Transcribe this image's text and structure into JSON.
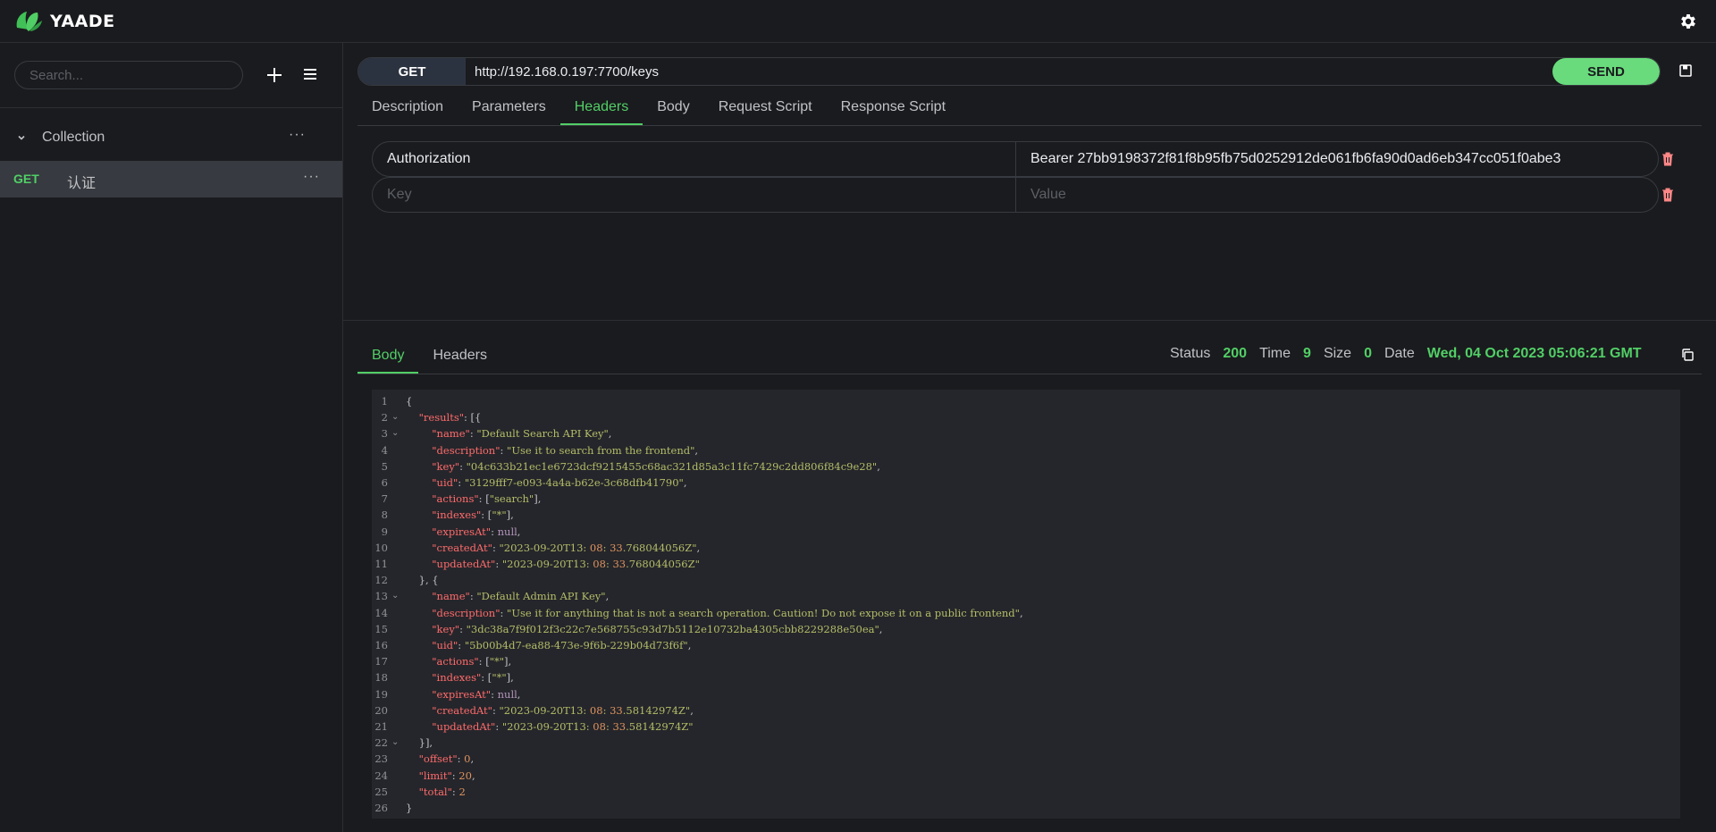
{
  "app": {
    "name": "YAADE"
  },
  "sidebar": {
    "search_placeholder": "Search...",
    "collection": {
      "label": "Collection"
    },
    "requests": [
      {
        "method": "GET",
        "name": "认证"
      }
    ]
  },
  "request": {
    "method": "GET",
    "url": "http://192.168.0.197:7700/keys",
    "send_label": "SEND",
    "tabs": [
      "Description",
      "Parameters",
      "Headers",
      "Body",
      "Request Script",
      "Response Script"
    ],
    "active_tab": "Headers",
    "headers": [
      {
        "key": "Authorization",
        "value": "Bearer 27bb9198372f81f8b95fb75d0252912de061fb6fa90d0ad6eb347cc051f0abe3"
      }
    ],
    "key_placeholder": "Key",
    "value_placeholder": "Value"
  },
  "response": {
    "tabs": [
      "Body",
      "Headers"
    ],
    "active_tab": "Body",
    "status_label": "Status",
    "status": "200",
    "time_label": "Time",
    "time": "9",
    "size_label": "Size",
    "size": "0",
    "date_label": "Date",
    "date": "Wed, 04 Oct 2023 05:06:21 GMT",
    "body_lines": [
      "{",
      "    \"results\": [{",
      "        \"name\": \"Default Search API Key\",",
      "        \"description\": \"Use it to search from the frontend\",",
      "        \"key\": \"04c633b21ec1e6723dcf9215455c68ac321d85a3c11fc7429c2dd806f84c9e28\",",
      "        \"uid\": \"3129fff7-e093-4a4a-b62e-3c68dfb41790\",",
      "        \"actions\": [\"search\"],",
      "        \"indexes\": [\"*\"],",
      "        \"expiresAt\": null,",
      "        \"createdAt\": \"2023-09-20T13:08:33.768044056Z\",",
      "        \"updatedAt\": \"2023-09-20T13:08:33.768044056Z\"",
      "    }, {",
      "        \"name\": \"Default Admin API Key\",",
      "        \"description\": \"Use it for anything that is not a search operation. Caution! Do not expose it on a public frontend\",",
      "        \"key\": \"3dc38a7f9f012f3c22c7e568755c93d7b5112e10732ba4305cbb8229288e50ea\",",
      "        \"uid\": \"5b00b4d7-ea88-473e-9f6b-229b04d73f6f\",",
      "        \"actions\": [\"*\"],",
      "        \"indexes\": [\"*\"],",
      "        \"expiresAt\": null,",
      "        \"createdAt\": \"2023-09-20T13:08:33.58142974Z\",",
      "        \"updatedAt\": \"2023-09-20T13:08:33.58142974Z\"",
      "    }],",
      "    \"offset\": 0,",
      "    \"limit\": 20,",
      "    \"total\": 2",
      "}"
    ],
    "fold_lines": [
      2,
      3,
      13,
      22
    ]
  },
  "colors": {
    "accent": "#51cf66",
    "send_bg": "#69db7c",
    "json_key": "#ff6b6b",
    "json_string": "#b5bd68",
    "json_number": "#de935f",
    "json_null": "#b294bb",
    "trash": "#ff8787"
  },
  "icons": [
    "logo-icon",
    "gear-icon",
    "plus-icon",
    "menu-icon",
    "chevron-down-icon",
    "more-icon",
    "save-icon",
    "trash-icon",
    "copy-icon"
  ]
}
